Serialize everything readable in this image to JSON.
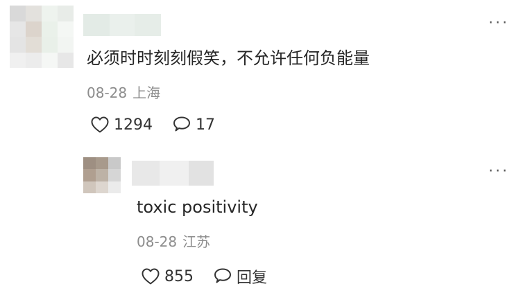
{
  "comment": {
    "text": "必须时时刻刻假笑，不允许任何负能量",
    "date": "08-28",
    "location": "上海",
    "likes": "1294",
    "replies": "17",
    "more": "···"
  },
  "reply": {
    "text": "toxic positivity",
    "date": "08-28",
    "location": "江苏",
    "likes": "855",
    "reply_label": "回复",
    "more": "···"
  },
  "icons": {
    "like": "heart-outline-icon",
    "comment": "speech-bubble-icon",
    "more": "ellipsis-icon"
  },
  "colors": {
    "text": "#262626",
    "meta": "#8c8c8c",
    "icon": "#333333"
  }
}
